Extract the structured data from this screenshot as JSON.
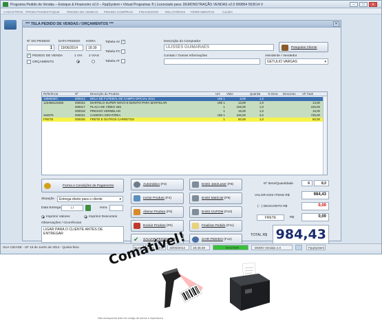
{
  "window": {
    "title": "Programa Pedido de Vendas – Estoque & Financeiro v2.0 – FpqSystem • Virtual Programas ® | Licenciado para: DEMONSTRAÇÃO VENDAS v2.0 999854 553514 V"
  },
  "menu": [
    "CADASTROS",
    "PRODUTOS/ESTOQUE",
    "PEDIDO DE VENDAS",
    "PEDIDO COMPRAS",
    "FINANCEIRO",
    "RELATÓRIOS",
    "FERRAMENTAS",
    "AJUDA"
  ],
  "dialog": {
    "title": "*** TELA PEDIDO DE VENDAS / ORÇAMENTOS ***",
    "close": "✕"
  },
  "order": {
    "num_label": "Nº DO PEDIDO",
    "num_value": "1",
    "date_label": "DATA PEDIDO",
    "date_value": "19/06/2014",
    "time_label": "HORA",
    "time_value": "18:39",
    "chk_pedido": "PEDIDO DE VENDA",
    "chk_orcamento": "ORÇAMENTO",
    "via1": "1 VIA",
    "via2": "2 VIAS",
    "tabela_av": "Tabela AV",
    "tabela_fc": "Tabela FC",
    "tabela_at": "Tabela AT"
  },
  "client": {
    "label": "Descrição do Comprador",
    "value": "ULISSES GUIMARAES",
    "search_button": "Pesquisar Cliente",
    "contact_label": "Contato / Outras Informações",
    "seller_label": "Atendente / Vendedor",
    "seller_value": "GETULIO VARGAS"
  },
  "grid": {
    "headers": [
      "Referência",
      "Nº",
      "Descrição do Produto",
      "Uni",
      "Valor",
      "Quantia",
      "% Desc",
      "Desconto",
      "Vlr Total"
    ],
    "rows": [
      {
        "ref": "1596825/C",
        "n": "000014",
        "desc": "BOLA DE FUTEBOL DE CAMPO OFICIAL 2014",
        "uni": "UNI 1",
        "val": "6,00",
        "qty": "1,0",
        "total": "",
        "style": "sel"
      },
      {
        "ref": "123456123456",
        "n": "000024",
        "desc": "MARTELO SUPER NOVO E BONITO PARA MARTELAR",
        "uni": "UNI 1",
        "val": "13,00",
        "qty": "1,0",
        "total": "13,00",
        "style": "green"
      },
      {
        "ref": "",
        "n": "000017",
        "desc": "PLACA DE VÍDEO 256",
        "uni": "1",
        "val": "106,00",
        "qty": "1,0",
        "total": "106,00",
        "style": "green"
      },
      {
        "ref": "",
        "n": "000018",
        "desc": "PRESSO VERMELHO",
        "uni": "1",
        "val": "15,00",
        "qty": "1,0",
        "total": "15,00",
        "style": "green"
      },
      {
        "ref": "454575",
        "n": "000021",
        "desc": "CADEIRA GIRATÓRIA",
        "uni": "UNI 1",
        "val": "245,00",
        "qty": "3,0",
        "total": "735,00",
        "style": "green"
      },
      {
        "ref": "FRETE",
        "n": "000026",
        "desc": "FRETE E OUTROS CARRETOS",
        "uni": "1",
        "val": "50,00",
        "qty": "1,0",
        "total": "50,00",
        "style": "yellow"
      }
    ]
  },
  "payment": {
    "button": "Forma e Condições de Pagamento",
    "situacao_label": "Situação",
    "situacao_value": "Entrega direto para o cliente",
    "delivery_label": "Data Entrega",
    "delivery_value": "/  /",
    "hora_label": "Hora",
    "print_values": "Imprimir Valores",
    "print_discounts": "Imprimir Descontos",
    "obs_label": "Observações / Ocorrências",
    "obs_value": "LIGAR PARA O CLIENTE ANTES DE ENTREGAR"
  },
  "actions": [
    {
      "label": "Automático",
      "key": "(F3)"
    },
    {
      "label": "Incluir Produto",
      "key": "(F4)"
    },
    {
      "label": "Alterar Produto",
      "key": "(F5)"
    },
    {
      "label": "Excluir Produto",
      "key": "(F6)"
    },
    {
      "label": "SALVAR PEDIDO",
      "key": "(F7)"
    },
    {
      "label": "Emitir Jato/Laser",
      "key": "(F8)"
    },
    {
      "label": "Emitir Matricial",
      "key": "(F9)"
    },
    {
      "label": "Emitir CUPOM",
      "key": "(F10)"
    },
    {
      "label": "Finalizar Pedido",
      "key": "(F11)"
    },
    {
      "label": "SAIR  PEDIDO",
      "key": "(F12)"
    }
  ],
  "summary": {
    "items_label": "Nº Itens/Quantidade",
    "items_value": "6",
    "qty_value": "8,0",
    "subtotal_label": "VALOR DOS ITENS R$",
    "subtotal_value": "984,43",
    "discount_label": "( - ) DESCONTO R$",
    "discount_value": "0,00",
    "frete_label": "FRETE",
    "frete_currency": "R$",
    "frete_value": "0,00",
    "total_label": "TOTAL R$",
    "total_value": "984,43"
  },
  "status": {
    "left": "SUA CIDADE - UF 19 de Junho de 2014 - Quinta-feira",
    "cells": [
      "Num",
      "Caps",
      "Ins",
      "19/06/2014",
      "18:45:48"
    ],
    "master": "MASTER",
    "version": "DEMO Vendas 2.0",
    "brand": "FpqSystem"
  },
  "promo": {
    "headline": "Comatível!",
    "caption": "Não acompanha leitor de código de barras e impressora"
  },
  "colors": {
    "selected_row": "#3c6fb0",
    "green_row": "#c7ddc0",
    "yellow_row": "#f6f34a",
    "total_red": "#cc0000",
    "total_blue": "#1a2c6e"
  }
}
